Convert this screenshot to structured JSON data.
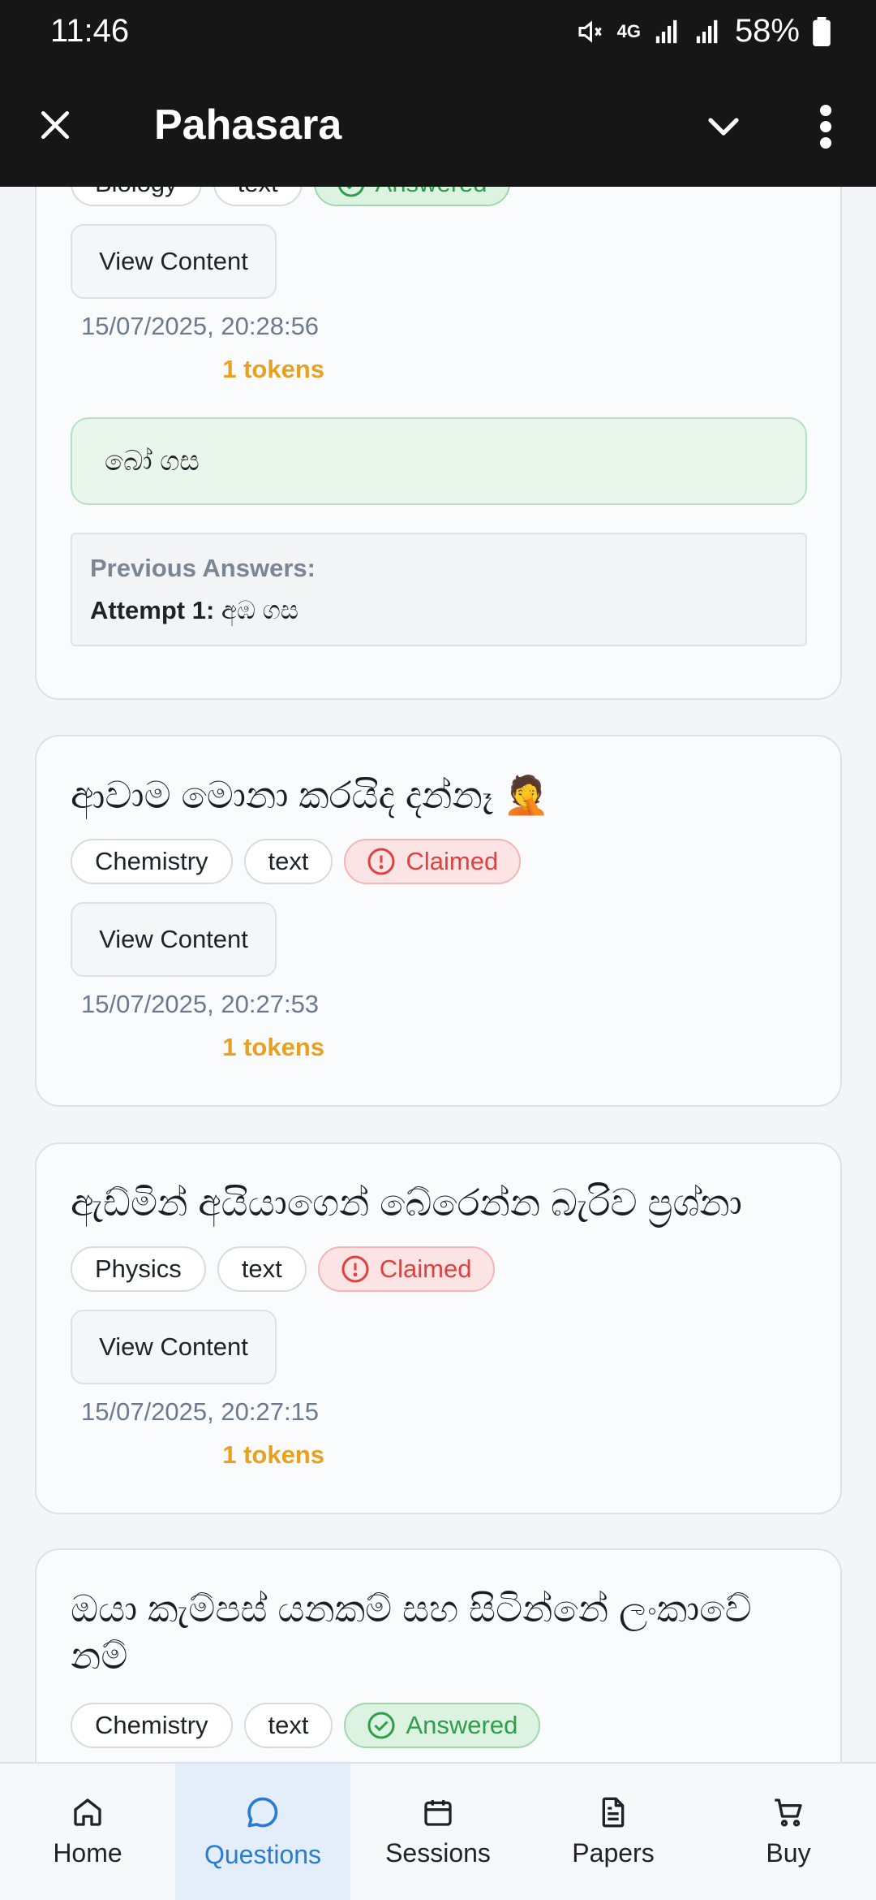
{
  "status_bar": {
    "time": "11:46",
    "network": "4G",
    "battery": "58%"
  },
  "app_bar": {
    "title": "Pahasara"
  },
  "cards": [
    {
      "tags": [
        "Biology",
        "text"
      ],
      "status": "Answered",
      "view_label": "View Content",
      "date": "15/07/2025, 20:28:56",
      "tokens": "1 tokens",
      "answer": "බෝ ගස",
      "previous_label": "Previous Answers:",
      "previous_attempt_label": "Attempt 1:",
      "previous_attempt_value": " අඹ ගස"
    },
    {
      "title": "ආවාම මොනා කරයිද දන්නෑ 🤦",
      "tags": [
        "Chemistry",
        "text"
      ],
      "status": "Claimed",
      "view_label": "View Content",
      "date": "15/07/2025, 20:27:53",
      "tokens": "1 tokens"
    },
    {
      "title": "ඇඩ්මින් අයියාගෙන් බේරෙන්න බැරිව ප්‍රශ්නා",
      "tags": [
        "Physics",
        "text"
      ],
      "status": "Claimed",
      "view_label": "View Content",
      "date": "15/07/2025, 20:27:15",
      "tokens": "1 tokens"
    },
    {
      "title_line1": "ඔයා කැම්පස් යනකම් සහ සිටින්නේ ලංකාවේ",
      "title_line2": "නම්",
      "tags": [
        "Chemistry",
        "text"
      ],
      "status": "Answered"
    }
  ],
  "bottom_nav": [
    {
      "label": "Home",
      "icon": "home-icon"
    },
    {
      "label": "Questions",
      "icon": "chat-bubble-icon",
      "active": true
    },
    {
      "label": "Sessions",
      "icon": "calendar-icon"
    },
    {
      "label": "Papers",
      "icon": "document-icon"
    },
    {
      "label": "Buy",
      "icon": "cart-icon"
    }
  ],
  "colors": {
    "accent": "#2a7bd2",
    "claimed": "#e04040",
    "answered": "#2e9e4a",
    "tokens": "#e8a021"
  }
}
